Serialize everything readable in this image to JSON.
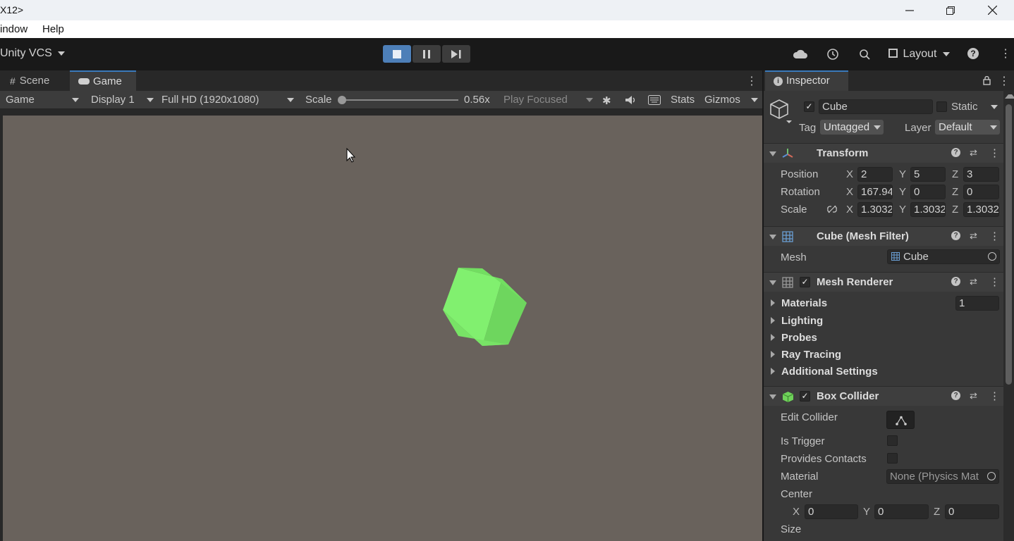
{
  "window": {
    "title": "X12>"
  },
  "menu": [
    "indow",
    "Help"
  ],
  "toolbar": {
    "vcs_label": "Unity VCS",
    "layout_label": "Layout"
  },
  "tabs": {
    "scene": "Scene",
    "game": "Game",
    "inspector": "Inspector"
  },
  "game_toolbar": {
    "mode": "Game",
    "display": "Display 1",
    "resolution": "Full HD (1920x1080)",
    "scale_label": "Scale",
    "scale_value": "0.56x",
    "scale_fraction": 0.0,
    "play_mode": "Play Focused",
    "stats": "Stats",
    "gizmos": "Gizmos"
  },
  "colors": {
    "cube": "#7ee86a",
    "viewport": "#69625c",
    "play_active": "#4d7fb8"
  },
  "object": {
    "active": true,
    "name": "Cube",
    "static_label": "Static",
    "tag_label": "Tag",
    "tag_value": "Untagged",
    "layer_label": "Layer",
    "layer_value": "Default"
  },
  "transform": {
    "title": "Transform",
    "position": {
      "label": "Position",
      "x": "2",
      "y": "5",
      "z": "3"
    },
    "rotation": {
      "label": "Rotation",
      "x": "167.94",
      "y": "0",
      "z": "0"
    },
    "scale": {
      "label": "Scale",
      "x": "1.3032",
      "y": "1.3032",
      "z": "1.3032"
    },
    "axes": {
      "x": "X",
      "y": "Y",
      "z": "Z"
    }
  },
  "mesh_filter": {
    "title": "Cube (Mesh Filter)",
    "mesh_label": "Mesh",
    "mesh_value": "Cube"
  },
  "mesh_renderer": {
    "title": "Mesh Renderer",
    "materials": "Materials",
    "materials_count": "1",
    "lighting": "Lighting",
    "probes": "Probes",
    "ray_tracing": "Ray Tracing",
    "additional": "Additional Settings"
  },
  "box_collider": {
    "title": "Box Collider",
    "edit_collider": "Edit Collider",
    "is_trigger": "Is Trigger",
    "provides_contacts": "Provides Contacts",
    "material_label": "Material",
    "material_value": "None (Physics Mat",
    "center_label": "Center",
    "center": {
      "x": "0",
      "y": "0",
      "z": "0"
    },
    "size_label": "Size"
  }
}
